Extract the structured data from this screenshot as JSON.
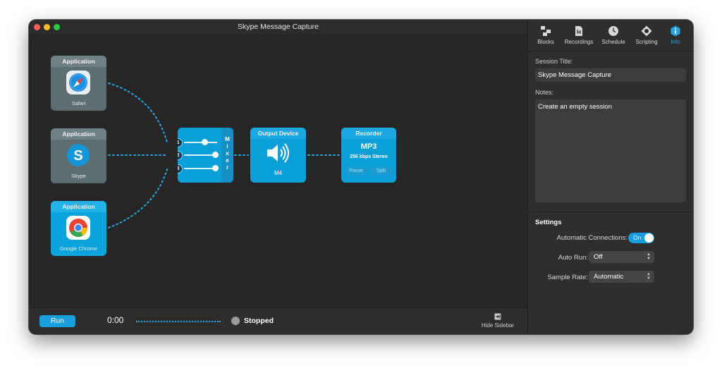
{
  "window": {
    "title": "Skype Message Capture"
  },
  "nodes": {
    "apps": [
      {
        "header": "Application",
        "name": "Safari",
        "icon": "safari-icon"
      },
      {
        "header": "Application",
        "name": "Skype",
        "icon": "skype-icon"
      },
      {
        "header": "Application",
        "name": "Google Chrome",
        "icon": "chrome-icon"
      }
    ],
    "mixer": {
      "label_letters": [
        "M",
        "i",
        "x",
        "e",
        "r"
      ],
      "inputs": [
        "1",
        "2",
        "3"
      ],
      "levels": [
        0.62,
        0.95,
        0.95
      ]
    },
    "output": {
      "header": "Output Device",
      "name": "M4",
      "icon": "speaker-icon"
    },
    "recorder": {
      "header": "Recorder",
      "format": "MP3",
      "detail": "256 kbps Stereo",
      "pause_label": "Pause",
      "split_label": "Split"
    }
  },
  "bottombar": {
    "run_label": "Run",
    "time": "0:00",
    "status": "Stopped",
    "hide_sidebar_label": "Hide Sidebar"
  },
  "sidebar": {
    "tabs": [
      {
        "label": "Blocks",
        "icon": "blocks-icon"
      },
      {
        "label": "Recordings",
        "icon": "recordings-icon"
      },
      {
        "label": "Schedule",
        "icon": "clock-icon"
      },
      {
        "label": "Scripting",
        "icon": "scripting-icon"
      },
      {
        "label": "Info",
        "icon": "info-icon",
        "active": true
      }
    ],
    "session_title_label": "Session Title:",
    "session_title_value": "Skype Message Capture",
    "notes_label": "Notes:",
    "notes_value": "Create an empty session",
    "settings_title": "Settings",
    "automatic_connections_label": "Automatic Connections:",
    "automatic_connections_value": "On",
    "auto_run_label": "Auto Run:",
    "auto_run_value": "Off",
    "sample_rate_label": "Sample Rate:",
    "sample_rate_value": "Automatic"
  },
  "colors": {
    "accent": "#19a0dc",
    "node_blue": "#0b9fd8",
    "inactive_node": "#5c6e72"
  }
}
